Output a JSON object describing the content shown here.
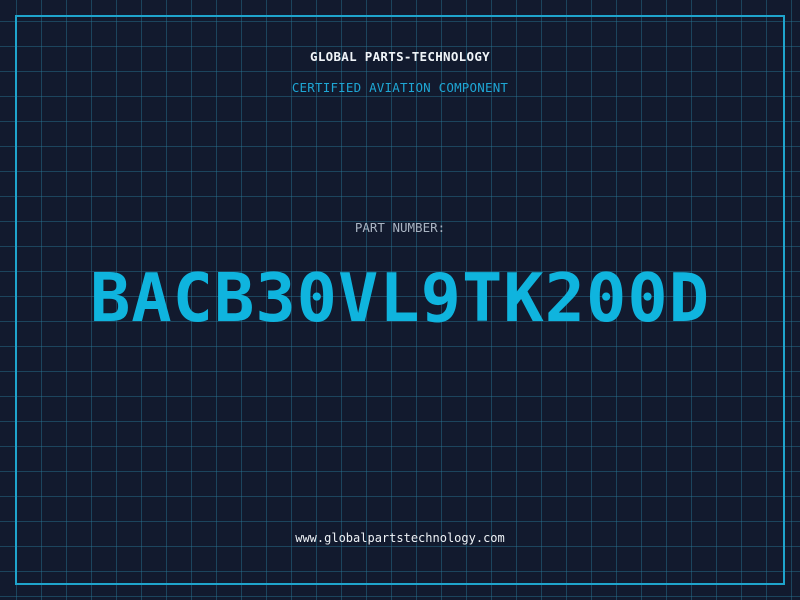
{
  "company": "GLOBAL PARTS-TECHNOLOGY",
  "subtitle": "CERTIFIED AVIATION COMPONENT",
  "part_number_label": "PART NUMBER:",
  "part_number": "BACB30VL9TK200D",
  "website": "www.globalpartstechnology.com",
  "colors": {
    "background": "#121a2e",
    "grid": "#28789a",
    "accent": "#0fb4de",
    "frame": "#1fa4cc"
  }
}
